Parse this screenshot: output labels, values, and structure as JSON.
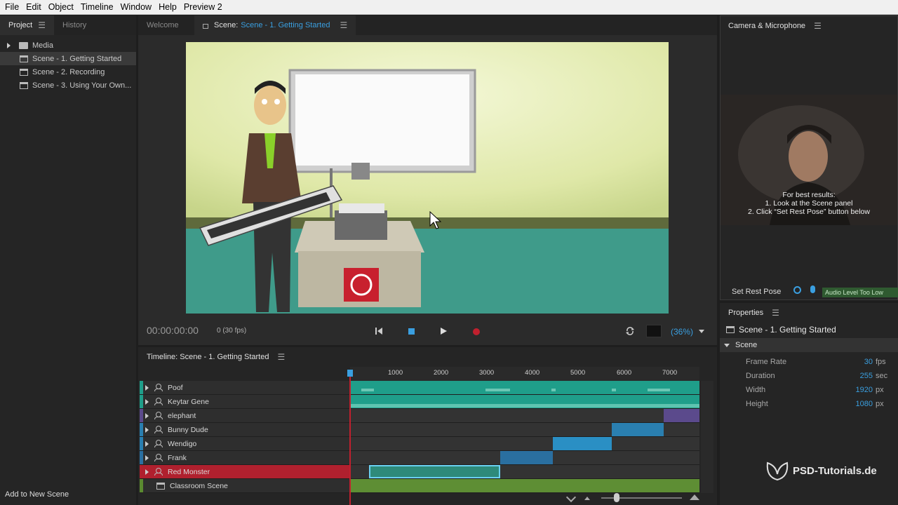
{
  "menu": [
    "File",
    "Edit",
    "Object",
    "Timeline",
    "Window",
    "Help",
    "Preview 2"
  ],
  "project_panel": {
    "tabs": [
      "Project",
      "History"
    ],
    "items": [
      {
        "label": "Media",
        "type": "folder"
      },
      {
        "label": "Scene - 1. Getting Started",
        "type": "scene",
        "selected": true
      },
      {
        "label": "Scene - 2. Recording",
        "type": "scene"
      },
      {
        "label": "Scene - 3. Using Your Own...",
        "type": "scene"
      }
    ],
    "add_scene": "Add to New Scene"
  },
  "scene_panel": {
    "tab_welcome": "Welcome",
    "tab_scene_prefix": "Scene:",
    "tab_scene_name": "Scene - 1. Getting Started",
    "timecode": "00:00:00:00",
    "frame": "0 (30 fps)",
    "zoom": "(36%)"
  },
  "camera_panel": {
    "title": "Camera & Microphone",
    "hint1": "For best results:",
    "hint2": "1. Look at the Scene panel",
    "hint3": "2. Click “Set Rest Pose” button below",
    "set_rest_pose": "Set Rest Pose",
    "audio_level": "Audio Level Too Low"
  },
  "properties": {
    "title": "Properties",
    "scene_name": "Scene - 1. Getting Started",
    "section": "Scene",
    "rows": [
      {
        "key": "Frame Rate",
        "value": "30",
        "unit": "fps"
      },
      {
        "key": "Duration",
        "value": "255",
        "unit": "sec"
      },
      {
        "key": "Width",
        "value": "1920",
        "unit": "px"
      },
      {
        "key": "Height",
        "value": "1080",
        "unit": "px"
      }
    ]
  },
  "timeline": {
    "title": "Timeline: Scene - 1. Getting Started",
    "ruler": [
      "1000",
      "2000",
      "3000",
      "4000",
      "5000",
      "6000",
      "7000"
    ],
    "tracks": [
      {
        "name": "Poof",
        "color": "#1f9e8a"
      },
      {
        "name": "Keytar Gene",
        "color": "#1f9e8a"
      },
      {
        "name": "elephant",
        "color": "#5b4a8c"
      },
      {
        "name": "Bunny Dude",
        "color": "#2a7fb0"
      },
      {
        "name": "Wendigo",
        "color": "#2a7fb0"
      },
      {
        "name": "Frank",
        "color": "#2a6fa0"
      },
      {
        "name": "Red Monster",
        "color": "#b0202e",
        "selected": true
      },
      {
        "name": "Classroom Scene",
        "color": "#5a8a30"
      }
    ]
  },
  "watermark": "PSD-Tutorials.de"
}
